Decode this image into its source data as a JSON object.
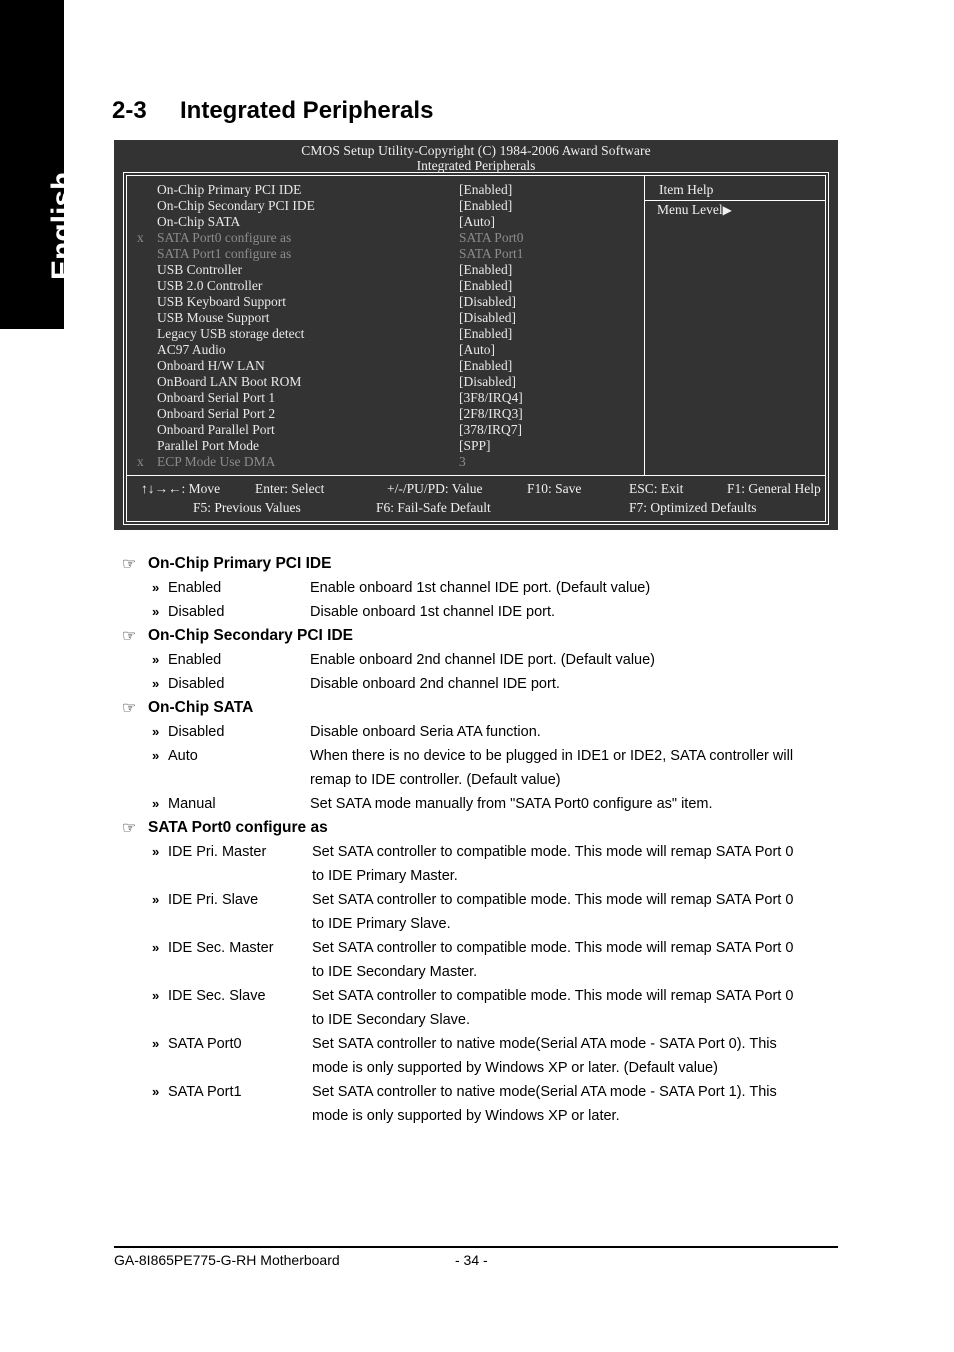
{
  "sidebar": {
    "language_label": "English"
  },
  "heading": {
    "number": "2-3",
    "title": "Integrated Peripherals"
  },
  "bios": {
    "title": "CMOS Setup Utility-Copyright (C) 1984-2006 Award Software",
    "subtitle": "Integrated Peripherals",
    "items": [
      {
        "x": "",
        "label": "On-Chip Primary PCI IDE",
        "value": "[Enabled]",
        "dim": false
      },
      {
        "x": "",
        "label": "On-Chip Secondary PCI IDE",
        "value": "[Enabled]",
        "dim": false
      },
      {
        "x": "",
        "label": "On-Chip SATA",
        "value": "[Auto]",
        "dim": false
      },
      {
        "x": "x",
        "label": "SATA Port0 configure as",
        "value": "SATA Port0",
        "dim": true
      },
      {
        "x": "",
        "label": "SATA Port1 configure as",
        "value": "SATA Port1",
        "dim": true
      },
      {
        "x": "",
        "label": "USB Controller",
        "value": "[Enabled]",
        "dim": false
      },
      {
        "x": "",
        "label": "USB 2.0 Controller",
        "value": "[Enabled]",
        "dim": false
      },
      {
        "x": "",
        "label": "USB Keyboard Support",
        "value": "[Disabled]",
        "dim": false
      },
      {
        "x": "",
        "label": "USB Mouse Support",
        "value": "[Disabled]",
        "dim": false
      },
      {
        "x": "",
        "label": "Legacy USB storage detect",
        "value": "[Enabled]",
        "dim": false
      },
      {
        "x": "",
        "label": "AC97 Audio",
        "value": "[Auto]",
        "dim": false
      },
      {
        "x": "",
        "label": "Onboard H/W LAN",
        "value": "[Enabled]",
        "dim": false
      },
      {
        "x": "",
        "label": "OnBoard LAN Boot ROM",
        "value": "[Disabled]",
        "dim": false
      },
      {
        "x": "",
        "label": "Onboard Serial Port 1",
        "value": "[3F8/IRQ4]",
        "dim": false
      },
      {
        "x": "",
        "label": "Onboard Serial Port 2",
        "value": "[2F8/IRQ3]",
        "dim": false
      },
      {
        "x": "",
        "label": "Onboard Parallel Port",
        "value": "[378/IRQ7]",
        "dim": false
      },
      {
        "x": "",
        "label": "Parallel Port Mode",
        "value": "[SPP]",
        "dim": false
      },
      {
        "x": "x",
        "label": "ECP Mode Use DMA",
        "value": "3",
        "dim": true
      }
    ],
    "help": {
      "title": "Item Help",
      "menu_level": "Menu Level",
      "menu_level_arrow": "▶"
    },
    "keys": {
      "move": "↑↓→←: Move",
      "enter": "Enter: Select",
      "value": "+/-/PU/PD: Value",
      "f10": "F10: Save",
      "esc": "ESC: Exit",
      "f1": "F1: General Help",
      "f5": "F5: Previous Values",
      "f6": "F6: Fail-Safe Default",
      "f7": "F7: Optimized Defaults"
    }
  },
  "glyphs": {
    "hand": "☞",
    "arrow": "»"
  },
  "sections": [
    {
      "title": "On-Chip Primary PCI IDE",
      "items": [
        {
          "option": "Enabled",
          "lines": [
            "Enable onboard 1st channel IDE port. (Default value)"
          ]
        },
        {
          "option": "Disabled",
          "lines": [
            "Disable onboard 1st channel IDE port."
          ]
        }
      ]
    },
    {
      "title": "On-Chip Secondary PCI IDE",
      "items": [
        {
          "option": "Enabled",
          "lines": [
            "Enable onboard 2nd channel IDE port. (Default value)"
          ]
        },
        {
          "option": "Disabled",
          "lines": [
            "Disable onboard 2nd channel IDE port."
          ]
        }
      ]
    },
    {
      "title": "On-Chip SATA",
      "items": [
        {
          "option": "Disabled",
          "lines": [
            "Disable onboard Seria ATA function."
          ]
        },
        {
          "option": "Auto",
          "lines": [
            "When there is no device to be plugged in IDE1 or IDE2, SATA controller will",
            "remap to IDE controller. (Default value)"
          ]
        },
        {
          "option": "Manual",
          "lines": [
            "Set SATA mode manually from \"SATA Port0 configure as\" item."
          ]
        }
      ]
    },
    {
      "title": "SATA Port0 configure as",
      "items": [
        {
          "option": "IDE Pri. Master",
          "lines": [
            "Set SATA controller to compatible mode. This mode will remap SATA Port 0",
            "to IDE Primary Master."
          ]
        },
        {
          "option": "IDE Pri. Slave",
          "lines": [
            "Set SATA controller to compatible mode. This mode will remap SATA Port 0",
            "to IDE Primary Slave."
          ]
        },
        {
          "option": "IDE Sec. Master",
          "lines": [
            "Set SATA controller to compatible mode. This mode will remap SATA Port 0",
            "to IDE Secondary Master."
          ]
        },
        {
          "option": "IDE Sec. Slave",
          "lines": [
            "Set SATA controller to compatible mode. This mode will remap SATA Port 0",
            "to IDE Secondary Slave."
          ]
        },
        {
          "option": "SATA Port0",
          "lines": [
            "Set SATA controller to native mode(Serial ATA mode - SATA Port 0). This",
            "mode is only supported by Windows XP or later. (Default value)"
          ]
        },
        {
          "option": "SATA Port1",
          "lines": [
            "Set SATA controller to native mode(Serial ATA mode - SATA Port 1). This",
            "mode is only supported by Windows XP or later."
          ]
        }
      ]
    }
  ],
  "footer": {
    "board": "GA-8I865PE775-G-RH Motherboard",
    "page": "- 34 -"
  }
}
